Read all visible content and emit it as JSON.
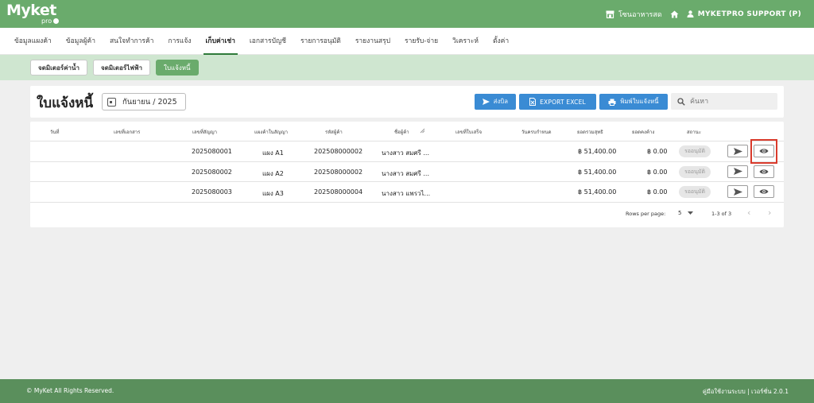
{
  "brand": {
    "name": "Myket",
    "sub": "pro"
  },
  "top": {
    "shop_label": "โซนอาหารสด",
    "user_label": "MYKETPRO SUPPORT (P)",
    "icons": {
      "shop": "store-icon",
      "home": "home-icon",
      "user": "user-icon"
    }
  },
  "nav": {
    "tabs": [
      {
        "label": "ข้อมูลแผงค้า"
      },
      {
        "label": "ข้อมูลผู้ค้า"
      },
      {
        "label": "สนใจทำการค้า"
      },
      {
        "label": "การแจ้ง"
      },
      {
        "label": "เก็บค่าเช่า"
      },
      {
        "label": "เอกสารบัญชี"
      },
      {
        "label": "รายการอนุมัติ"
      },
      {
        "label": "รายงานสรุป"
      },
      {
        "label": "รายรับ-จ่าย"
      },
      {
        "label": "วิเคราะห์"
      },
      {
        "label": "ตั้งค่า"
      }
    ],
    "active_index": 4
  },
  "subnav": {
    "items": [
      {
        "label": "จดมิเตอร์ค่าน้ำ"
      },
      {
        "label": "จดมิเตอร์ไฟฟ้า"
      },
      {
        "label": "ใบแจ้งหนี้"
      }
    ],
    "active_index": 2
  },
  "toolbar": {
    "title": "ใบแจ้งหนี้",
    "date_value": "กันยายน / 2025",
    "send_label": "ส่งบิล",
    "excel_label": "EXPORT EXCEL",
    "print_label": "พิมพ์ใบแจ้งหนี้",
    "search_placeholder": "ค้นหา"
  },
  "table": {
    "columns": [
      "วันที่",
      "เลขที่เอกสาร",
      "เลขที่สัญญา",
      "แผงค้าในสัญญา",
      "รหัสผู้ค้า",
      "ชื่อผู้ค้า",
      "เลขที่ใบเสร็จ",
      "วันครบกำหนด",
      "ยอดรวมสุทธิ",
      "ยอดคงค้าง",
      "สถานะ"
    ],
    "rows": [
      {
        "date": "",
        "doc_no": "",
        "contract_no": "2025080001",
        "stall": "แผง A1",
        "vendor_code": "202508000002",
        "vendor_name": "นางสาว สมศรี ...",
        "receipt_no": "",
        "due_date": "",
        "net_total": "฿ 51,400.00",
        "outstanding": "฿ 0.00",
        "status": "รออนุมัติ"
      },
      {
        "date": "",
        "doc_no": "",
        "contract_no": "2025080002",
        "stall": "แผง A2",
        "vendor_code": "202508000002",
        "vendor_name": "นางสาว สมศรี ...",
        "receipt_no": "",
        "due_date": "",
        "net_total": "฿ 51,400.00",
        "outstanding": "฿ 0.00",
        "status": "รออนุมัติ"
      },
      {
        "date": "",
        "doc_no": "",
        "contract_no": "2025080003",
        "stall": "แผง A3",
        "vendor_code": "202508000004",
        "vendor_name": "นางสาว แพรวไ...",
        "receipt_no": "",
        "due_date": "",
        "net_total": "฿ 51,400.00",
        "outstanding": "฿ 0.00",
        "status": "รออนุมัติ"
      }
    ]
  },
  "pagination": {
    "rows_label": "Rows per page:",
    "rows_value": "5",
    "range": "1-3 of 3"
  },
  "footer": {
    "copyright": "© MyKet All Rights Reserved.",
    "right": "คู่มือใช้งานระบบ | เวอร์ชั่น 2.0.1"
  },
  "colors": {
    "brand_green": "#6aab6c",
    "sub_green": "#cfe6d0",
    "footer_green": "#5a8f5c",
    "primary_blue": "#3a8bd4",
    "highlight_red": "#d93a2b"
  }
}
